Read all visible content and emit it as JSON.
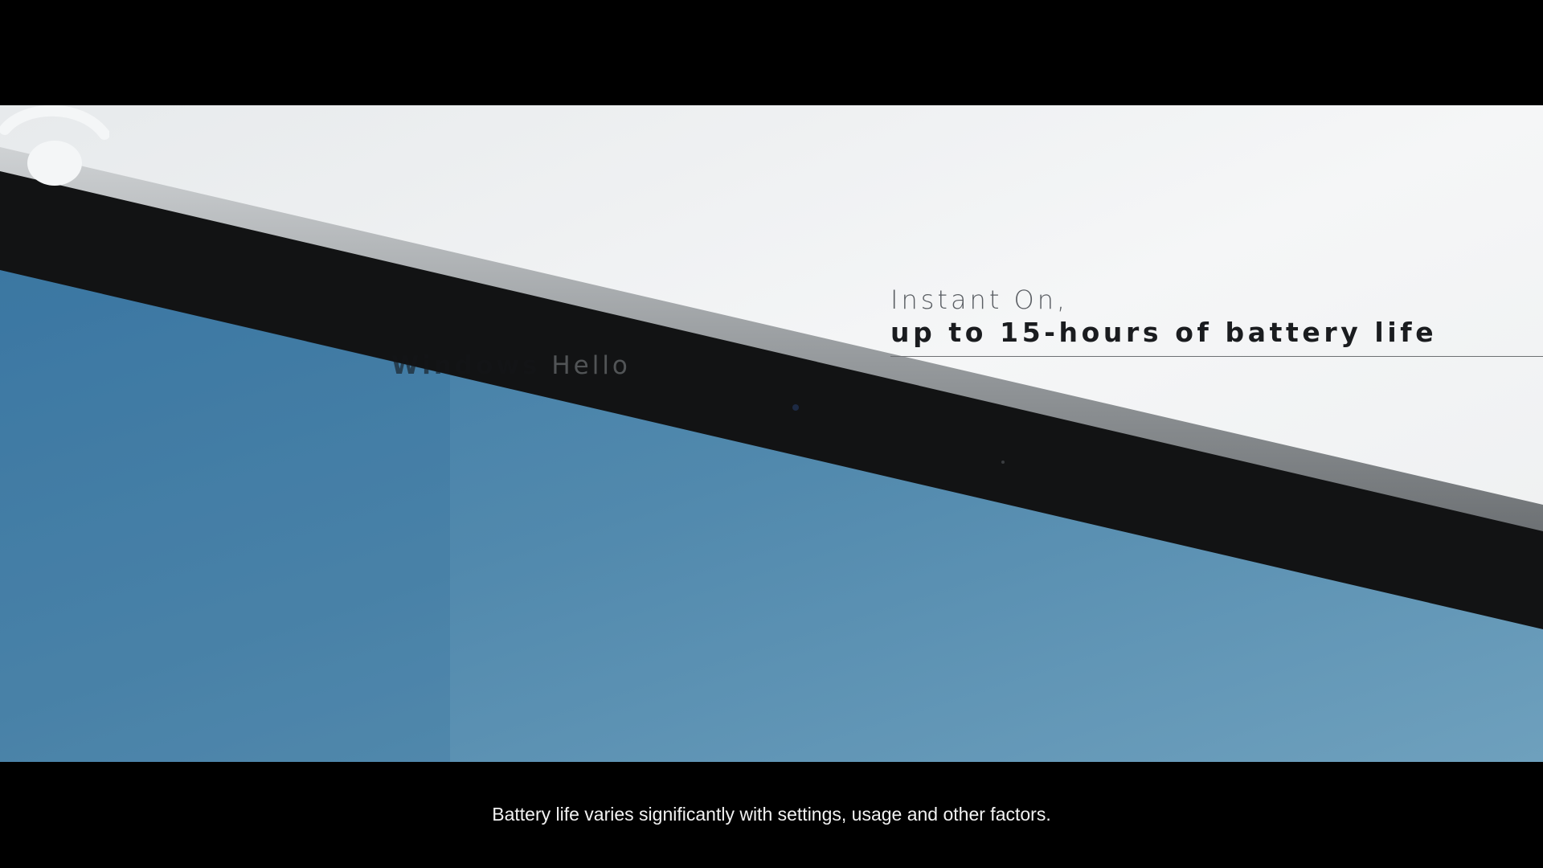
{
  "overlay": {
    "word_1": "Windows",
    "word_2": "Hello"
  },
  "headline": {
    "line_1": "Instant On,",
    "line_2": "up to 15-hours of battery life"
  },
  "caption": {
    "text": "Battery life varies significantly with settings, usage and other factors."
  },
  "colors": {
    "background_sky": "#eef0f1",
    "screen_blue": "#4f87aa",
    "bezel": "#121314",
    "caption_text": "#f2f2f2"
  },
  "icons": {
    "windows_hello": "windows-hello-face-icon"
  }
}
